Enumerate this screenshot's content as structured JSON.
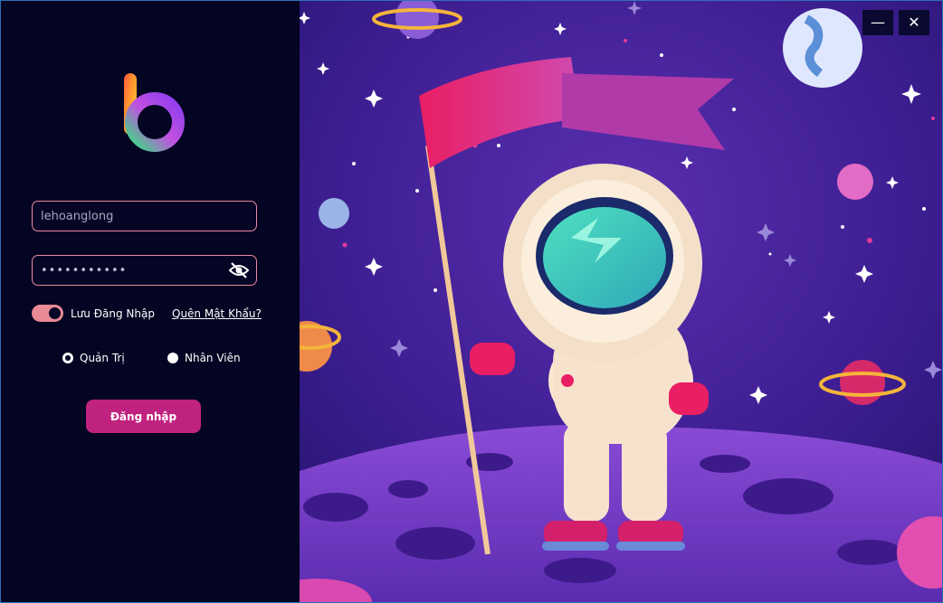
{
  "window": {
    "minimize_icon": "minimize-icon",
    "close_icon": "close-icon",
    "minimize_glyph": "—",
    "close_glyph": "✕"
  },
  "login": {
    "username_value": "lehoanglong",
    "password_value": "•••••••••••",
    "password_toggle_icon": "eye-slash-icon",
    "remember_label": "Lưu Đăng Nhập",
    "remember_on": true,
    "forgot_label": "Quên Mật Khẩu?",
    "roles": [
      {
        "label": "Quản Trị",
        "selected": true
      },
      {
        "label": "Nhân Viên",
        "selected": false
      }
    ],
    "submit_label": "Đăng nhập"
  },
  "colors": {
    "accent_pink": "#c0227f",
    "field_border": "#e98aa0",
    "panel_bg": "#040423"
  }
}
